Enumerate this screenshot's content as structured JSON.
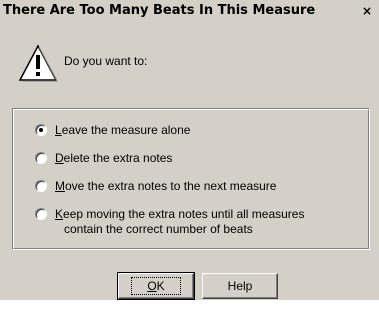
{
  "dialog": {
    "title": "There Are Too Many Beats In This Measure",
    "close_glyph": "×",
    "prompt": "Do you want to:",
    "options": [
      {
        "mnemonic": "L",
        "rest": "eave the measure alone",
        "checked": true
      },
      {
        "mnemonic": "D",
        "rest": "elete the extra notes",
        "checked": false
      },
      {
        "mnemonic": "M",
        "rest": "ove the extra notes to the next measure",
        "checked": false
      },
      {
        "mnemonic": "K",
        "rest": "eep moving the extra notes until all measures",
        "line2": "contain the correct number of beats",
        "checked": false
      }
    ],
    "ok_mnemonic": "O",
    "ok_rest": "K",
    "help_label": "Help"
  },
  "icons": {
    "warning": "warning-icon",
    "close": "close-icon"
  }
}
